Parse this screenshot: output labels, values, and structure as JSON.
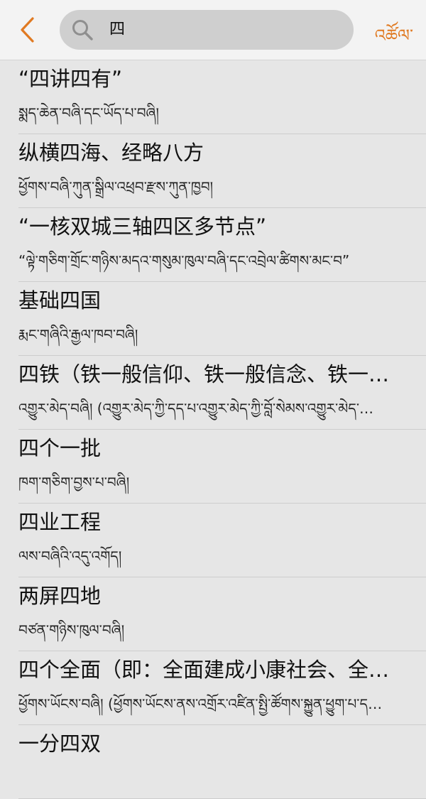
{
  "header": {
    "back_label": "‹",
    "search_value": "四",
    "search_placeholder": "",
    "action_label": "འཚོལ་",
    "accent_color": "#e07a22"
  },
  "results": [
    {
      "zh": "“四讲四有”",
      "bo": "སྨད་ཆེན་བཞི་དང་ཡོད་པ་བཞི།"
    },
    {
      "zh": "纵横四海、经略八方",
      "bo": "ཕྱོགས་བཞི་ཀུན་སྒྲིལ་འཕྲབ་རྫས་ཀུན་ཁྱབ།"
    },
    {
      "zh": "“一核双城三轴四区多节点”",
      "bo": "“ལྟེ་གཅིག་གྲོང་གཉིས་མདའ་གསུམ་ཁུལ་བཞི་དང་འབྲེལ་ཚིགས་མང་བ”"
    },
    {
      "zh": "基础四国",
      "bo": "རྨང་གཞིའི་རྒྱལ་ཁབ་བཞི།"
    },
    {
      "zh": "四铁（铁一般信仰、铁一般信念、铁一…",
      "bo": "འགྱུར་མེད་བཞི། (འགྱུར་མེད་ཀྱི་དད་པ་འགྱུར་མེད་ཀྱི་བློ་སེམས་འགྱུར་མེད་…"
    },
    {
      "zh": "四个一批",
      "bo": "ཁག་གཅིག་བྱས་པ་བཞི།"
    },
    {
      "zh": "四业工程",
      "bo": "ལས་བཞིའི་འདུ་འགོད།"
    },
    {
      "zh": "两屏四地",
      "bo": "བཙན་གཉིས་ཁུལ་བཞི།"
    },
    {
      "zh": "四个全面（即：全面建成小康社会、全…",
      "bo": "ཕྱོགས་ཡོངས་བཞི། (ཕྱོགས་ཡོངས་ནས་འགྲོར་འཛིན་སྤྱི་ཚོགས་སྐྱུན་ཕྱུག་པ་ད…"
    },
    {
      "zh": "一分四双",
      "bo": ""
    }
  ]
}
